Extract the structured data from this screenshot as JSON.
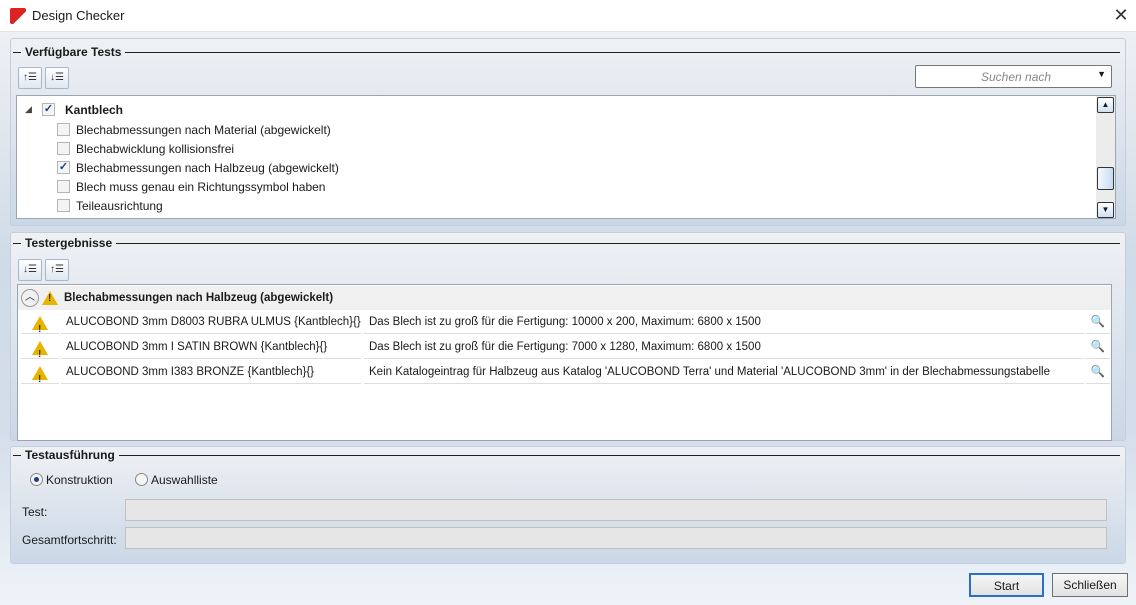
{
  "window": {
    "title": "Design Checker",
    "close": "✕"
  },
  "available": {
    "title": "Verfügbare Tests",
    "search_placeholder": "Suchen nach",
    "group": {
      "label": "Kantblech",
      "checked": true
    },
    "items": [
      {
        "label": "Blechabmessungen nach Material (abgewickelt)",
        "checked": false
      },
      {
        "label": "Blechabwicklung kollisionsfrei",
        "checked": false
      },
      {
        "label": "Blechabmessungen nach Halbzeug (abgewickelt)",
        "checked": true
      },
      {
        "label": "Blech muss genau ein Richtungssymbol haben",
        "checked": false
      },
      {
        "label": "Teileausrichtung",
        "checked": false
      }
    ]
  },
  "results": {
    "title": "Testergebnisse",
    "group": "Blechabmessungen nach Halbzeug (abgewickelt)",
    "rows": [
      {
        "name": "ALUCOBOND 3mm D8003 RUBRA ULMUS {Kantblech}{}",
        "message": "Das Blech ist zu groß für die Fertigung: 10000 x 200, Maximum: 6800 x 1500"
      },
      {
        "name": "ALUCOBOND 3mm I SATIN BROWN {Kantblech}{}",
        "message": "Das Blech ist zu groß für die Fertigung: 7000 x 1280, Maximum: 6800 x 1500"
      },
      {
        "name": "ALUCOBOND 3mm I383 BRONZE {Kantblech}{}",
        "message": "Kein Katalogeintrag für Halbzeug aus Katalog 'ALUCOBOND Terra' und Material 'ALUCOBOND 3mm' in der Blechabmessungstabelle"
      }
    ]
  },
  "execution": {
    "title": "Testausführung",
    "radio1": "Konstruktion",
    "radio2": "Auswahlliste",
    "selected": "Konstruktion",
    "test_label": "Test:",
    "total_label": "Gesamtfortschritt:",
    "test_progress": 0,
    "total_progress": 0
  },
  "buttons": {
    "start": "Start",
    "close": "Schließen"
  }
}
